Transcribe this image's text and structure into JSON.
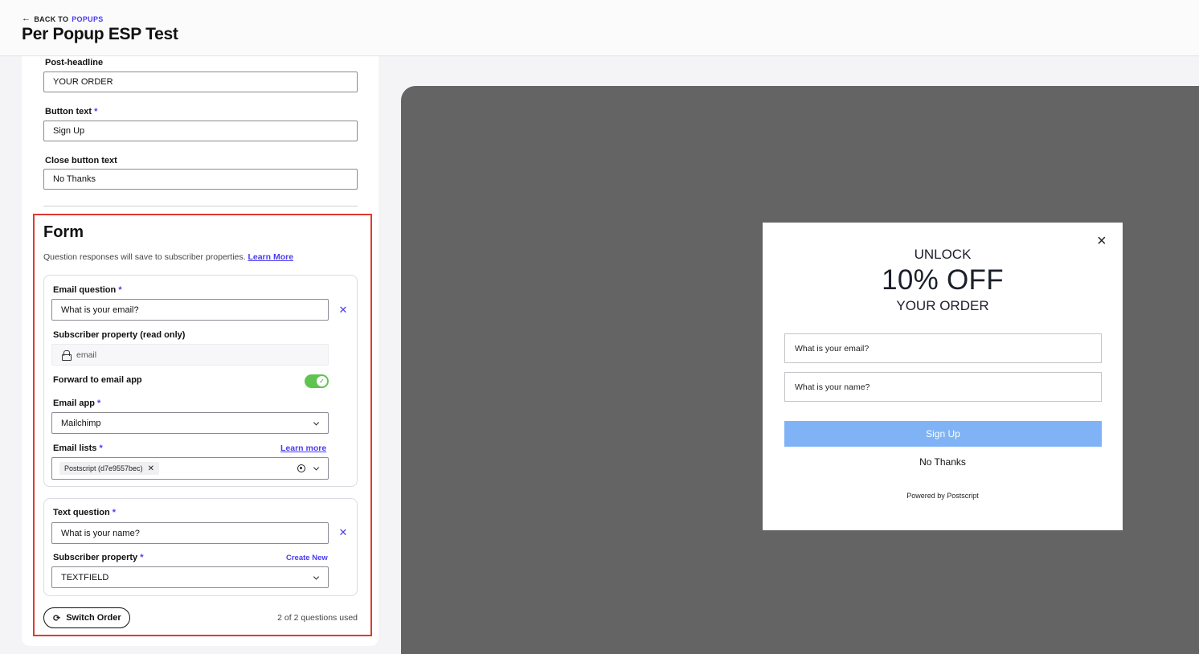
{
  "header": {
    "back_prefix": "BACK TO",
    "back_target": "POPUPS",
    "title": "Per Popup ESP Test"
  },
  "editor": {
    "post_headline": {
      "label": "Post-headline",
      "value": "YOUR ORDER"
    },
    "button_text": {
      "label": "Button text",
      "required_mark": "*",
      "value": "Sign Up"
    },
    "close_button_text": {
      "label": "Close button text",
      "value": "No Thanks"
    },
    "form": {
      "title": "Form",
      "description": "Question responses will save to subscriber properties.",
      "learn_more": "Learn More",
      "email_question": {
        "label": "Email question",
        "required_mark": "*",
        "value": "What is your email?",
        "subscriber_property_label": "Subscriber property (read only)",
        "subscriber_property_value": "email",
        "forward_label": "Forward to email app",
        "forward_enabled": true,
        "email_app_label": "Email app",
        "email_app_value": "Mailchimp",
        "email_lists_label": "Email lists",
        "email_lists_link": "Learn more",
        "email_lists_selected": [
          "Postscript (d7e9557bec)"
        ]
      },
      "text_question": {
        "label": "Text question",
        "required_mark": "*",
        "value": "What is your name?",
        "subscriber_property_label": "Subscriber property",
        "create_new": "Create New",
        "subscriber_property_value": "TEXTFIELD"
      },
      "switch_order": "Switch Order",
      "questions_used": "2 of 2 questions used"
    }
  },
  "preview": {
    "pre_headline": "UNLOCK",
    "headline": "10% OFF",
    "post_headline": "YOUR ORDER",
    "email_placeholder": "What is your email?",
    "name_placeholder": "What is your name?",
    "submit": "Sign Up",
    "close_text": "No Thanks",
    "powered_by": "Powered by Postscript",
    "close_icon": "×"
  },
  "colors": {
    "accent": "#4b3cf0",
    "highlight_border": "#e03a2e",
    "toggle_on": "#5fc44f",
    "preview_backdrop": "#646464",
    "popup_button": "#80b3f5"
  }
}
